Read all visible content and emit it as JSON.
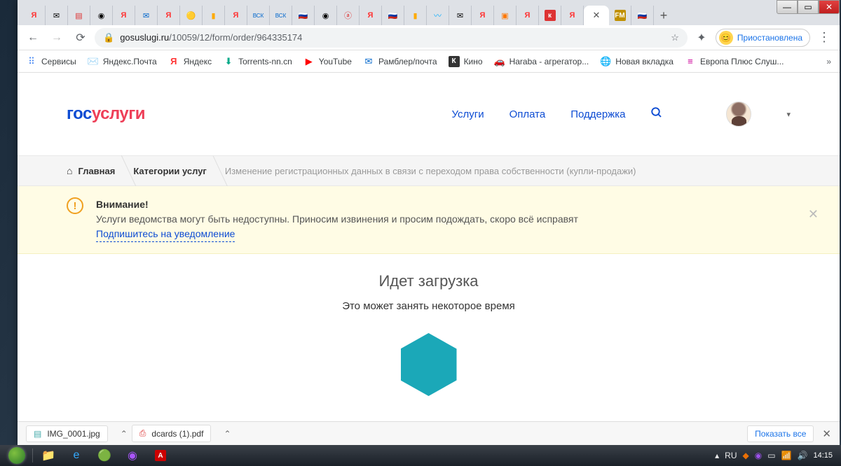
{
  "window": {
    "profile_status": "Приостановлена"
  },
  "address": {
    "host": "gosuslugi.ru",
    "path": "/10059/12/form/order/964335174"
  },
  "bookmarks": [
    {
      "label": "Сервисы",
      "icon": "apps"
    },
    {
      "label": "Яндекс.Почта",
      "icon": "mail-yellow"
    },
    {
      "label": "Яндекс",
      "icon": "ya"
    },
    {
      "label": "Torrents-nn.cn",
      "icon": "torrent"
    },
    {
      "label": "YouTube",
      "icon": "yt"
    },
    {
      "label": "Рамблер/почта",
      "icon": "rambler"
    },
    {
      "label": "Кино",
      "icon": "kino"
    },
    {
      "label": "Haraba - агрегатор...",
      "icon": "car"
    },
    {
      "label": "Новая вкладка",
      "icon": "globe"
    },
    {
      "label": "Европа Плюс Слуш...",
      "icon": "europa"
    }
  ],
  "site": {
    "logo_part1": "гос",
    "logo_part2": "услуги",
    "nav": [
      "Услуги",
      "Оплата",
      "Поддержка"
    ]
  },
  "breadcrumb": [
    {
      "label": "Главная",
      "home": true
    },
    {
      "label": "Категории услуг"
    },
    {
      "label": "Изменение регистрационных данных в связи с переходом права собственности (купли-продажи)",
      "last": true
    }
  ],
  "alert": {
    "title": "Внимание!",
    "text": "Услуги ведомства могут быть недоступны. Приносим извинения и просим подождать, скоро всё исправят",
    "link": "Подпишитесь на уведомление"
  },
  "loading": {
    "heading": "Идет загрузка",
    "sub": "Это может занять некоторое время"
  },
  "downloads": {
    "items": [
      "IMG_0001.jpg",
      "dcards (1).pdf"
    ],
    "show_all": "Показать все"
  },
  "tray": {
    "lang": "RU",
    "time": "14:15"
  }
}
